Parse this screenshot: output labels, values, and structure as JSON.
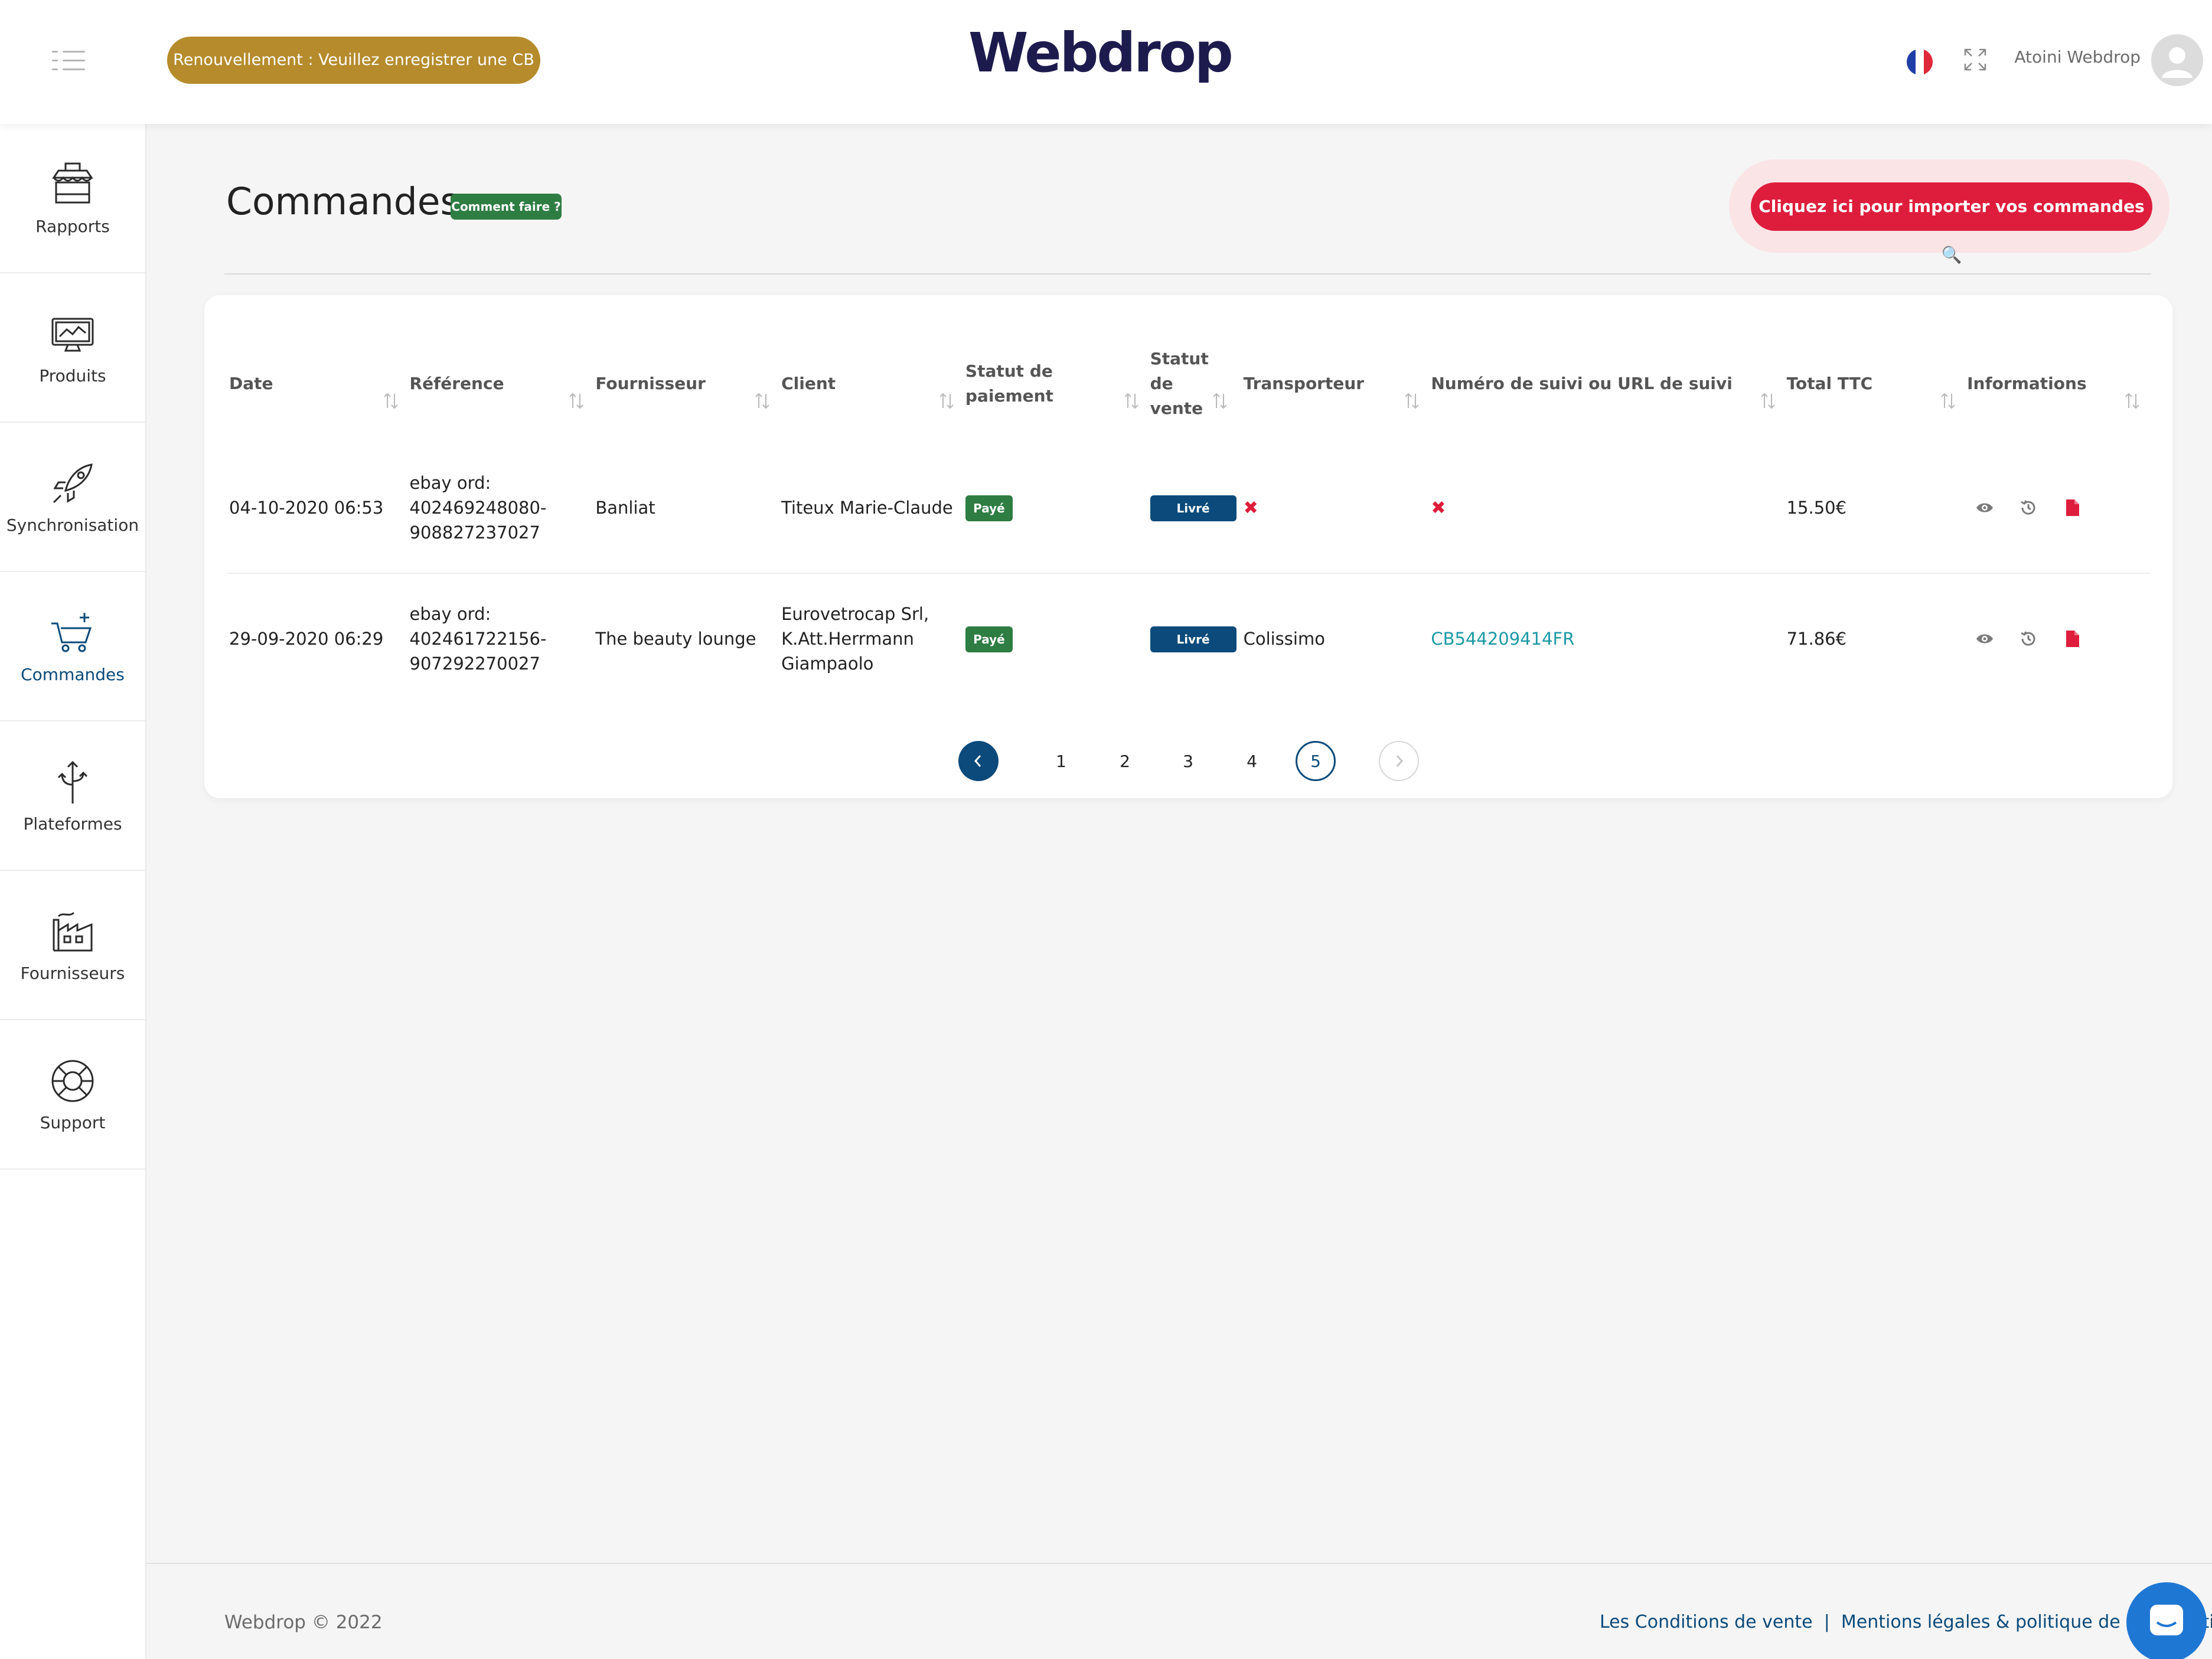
{
  "header": {
    "renew_label": "Renouvellement : Veuillez enregistrer une CB",
    "logo": "Webdrop",
    "user_name": "Atoini Webdrop"
  },
  "sidebar": {
    "items": [
      {
        "label": "Rapports",
        "icon": "store-icon"
      },
      {
        "label": "Produits",
        "icon": "monitor-icon"
      },
      {
        "label": "Synchronisation",
        "icon": "rocket-icon"
      },
      {
        "label": "Commandes",
        "icon": "cart-icon"
      },
      {
        "label": "Plateformes",
        "icon": "arrows-icon"
      },
      {
        "label": "Fournisseurs",
        "icon": "factory-icon"
      },
      {
        "label": "Support",
        "icon": "lifebuoy-icon"
      }
    ]
  },
  "main": {
    "title": "Commandes",
    "help_label": "Comment faire ?",
    "import_label": "Cliquez ici pour importer vos commandes 🔍"
  },
  "table": {
    "headers": {
      "date": "Date",
      "reference": "Référence",
      "fournisseur": "Fournisseur",
      "client": "Client",
      "payment_status_1": "Statut de",
      "payment_status_2": "paiement",
      "sale_status_1": "Statut",
      "sale_status_2": "de",
      "sale_status_3": "vente",
      "transporteur": "Transporteur",
      "tracking": "Numéro de suivi ou URL de suivi",
      "total": "Total TTC",
      "informations": "Informations"
    },
    "rows": [
      {
        "date": "04-10-2020 06:53",
        "ref_1": "ebay ord:",
        "ref_2": "402469248080-",
        "ref_3": "908827237027",
        "fournisseur": "Banliat",
        "client_1": "Titeux Marie-Claude",
        "client_2": "",
        "client_3": "",
        "payment": "Payé",
        "sale": "Livré",
        "transporteur": "✖",
        "tracking": "✖",
        "total": "15.50€"
      },
      {
        "date": "29-09-2020 06:29",
        "ref_1": "ebay ord:",
        "ref_2": "402461722156-",
        "ref_3": "907292270027",
        "fournisseur": "The beauty lounge",
        "client_1": "Eurovetrocap Srl,",
        "client_2": "K.Att.Herrmann",
        "client_3": "Giampaolo",
        "payment": "Payé",
        "sale": "Livré",
        "transporteur": "Colissimo",
        "tracking": "CB544209414FR",
        "total": "71.86€"
      }
    ]
  },
  "pagination": {
    "pages": [
      "1",
      "2",
      "3",
      "4",
      "5"
    ],
    "current": "5"
  },
  "footer": {
    "brand": "Webdrop",
    "copyright": "©",
    "year": "2022",
    "link_cgv": "Les Conditions de vente",
    "separator": "|",
    "link_legal": "Mentions légales & politique de confidentia"
  },
  "colors": {
    "accent_blue": "#0b4a7a",
    "brand_red": "#de1d3c",
    "gold": "#b58b2c",
    "green": "#2e7d43",
    "link_teal": "#1a9aa6"
  }
}
